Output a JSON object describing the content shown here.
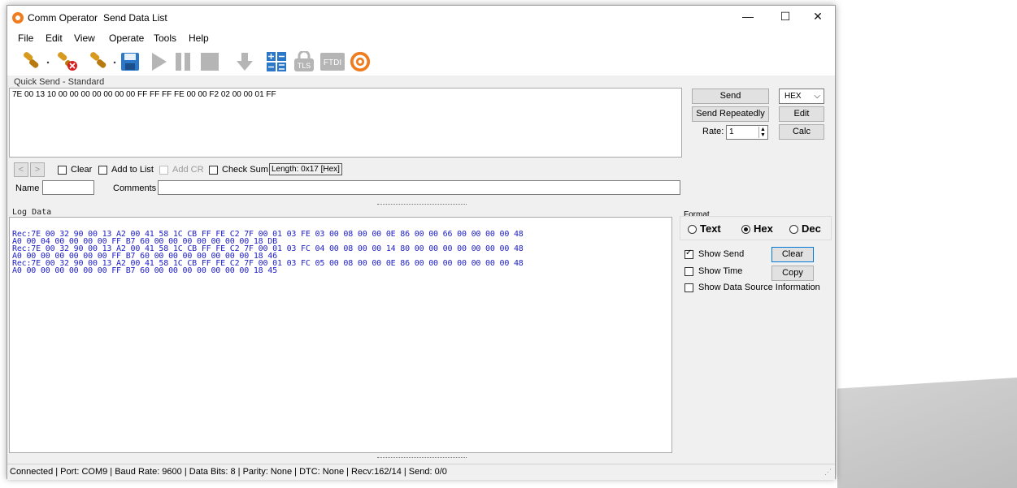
{
  "window": {
    "app_title": "Comm Operator",
    "doc_title": "Send Data List",
    "min": "—",
    "max": "☐",
    "close": "✕"
  },
  "menu": [
    "File",
    "Edit",
    "View",
    "Operate",
    "Tools",
    "Help"
  ],
  "quick_send": {
    "label": "Quick Send - Standard",
    "value": "7E 00 13 10 00 00 00 00 00 00 00 FF FF FF FE 00 00 F2 02 00 00 01 FF",
    "send_label": "Send",
    "send_repeatedly_label": "Send Repeatedly",
    "rate_label": "Rate:",
    "rate_value": "1",
    "format_value": "HEX",
    "edit_label": "Edit",
    "calc_label": "Calc",
    "prev": "<",
    "next": ">",
    "clear_label": "Clear",
    "add_to_list_label": "Add to List",
    "add_cr_label": "Add CR",
    "check_sum_label": "Check Sum",
    "length_text": "Length: 0x17 [Hex]",
    "name_label": "Name",
    "comments_label": "Comments"
  },
  "log": {
    "label": "Log Data",
    "lines": [
      "Rec:7E 00 32 90 00 13 A2 00 41 58 1C CB FF FE C2 7F 00 01 03 FE 03 00 08 00 00 0E 86 00 00 66 00 00 00 00 48",
      "A0 00 04 00 00 00 00 FF B7 60 00 00 00 00 00 00 00 18 DB",
      "Rec:7E 00 32 90 00 13 A2 00 41 58 1C CB FF FE C2 7F 00 01 03 FC 04 00 08 00 00 14 80 00 00 00 00 00 00 00 48",
      "A0 00 00 00 00 00 00 FF B7 60 00 00 00 00 00 00 00 18 46",
      "Rec:7E 00 32 90 00 13 A2 00 41 58 1C CB FF FE C2 7F 00 01 03 FC 05 00 08 00 00 0E 86 00 00 00 00 00 00 00 48",
      "A0 00 00 00 00 00 00 FF B7 60 00 00 00 00 00 00 00 18 45"
    ],
    "format_title": "Format",
    "format_options": [
      "Text",
      "Hex",
      "Dec"
    ],
    "format_selected": "Hex",
    "show_send_label": "Show Send",
    "show_time_label": "Show Time",
    "show_source_label": "Show Data Source Information",
    "clear_label": "Clear",
    "copy_label": "Copy"
  },
  "status": {
    "text": "Connected | Port: COM9 | Baud Rate: 9600 | Data Bits: 8 | Parity: None | DTC: None | Recv:162/14 | Send: 0/0"
  },
  "toolbar": {
    "icons": [
      "connect-icon",
      "disconnect-icon",
      "connect-all-icon",
      "save-icon",
      "play-icon",
      "pause-icon",
      "stop-icon",
      "download-icon",
      "calculator-icon",
      "tls-icon",
      "ftdi-icon",
      "comm-operator-logo-icon"
    ],
    "tls_text": "TLS",
    "ftdi_text": "FTDI"
  },
  "colors": {
    "log_text": "#2020c8",
    "accent": "#f07c20",
    "toolbar_blue": "#2c78c8"
  }
}
